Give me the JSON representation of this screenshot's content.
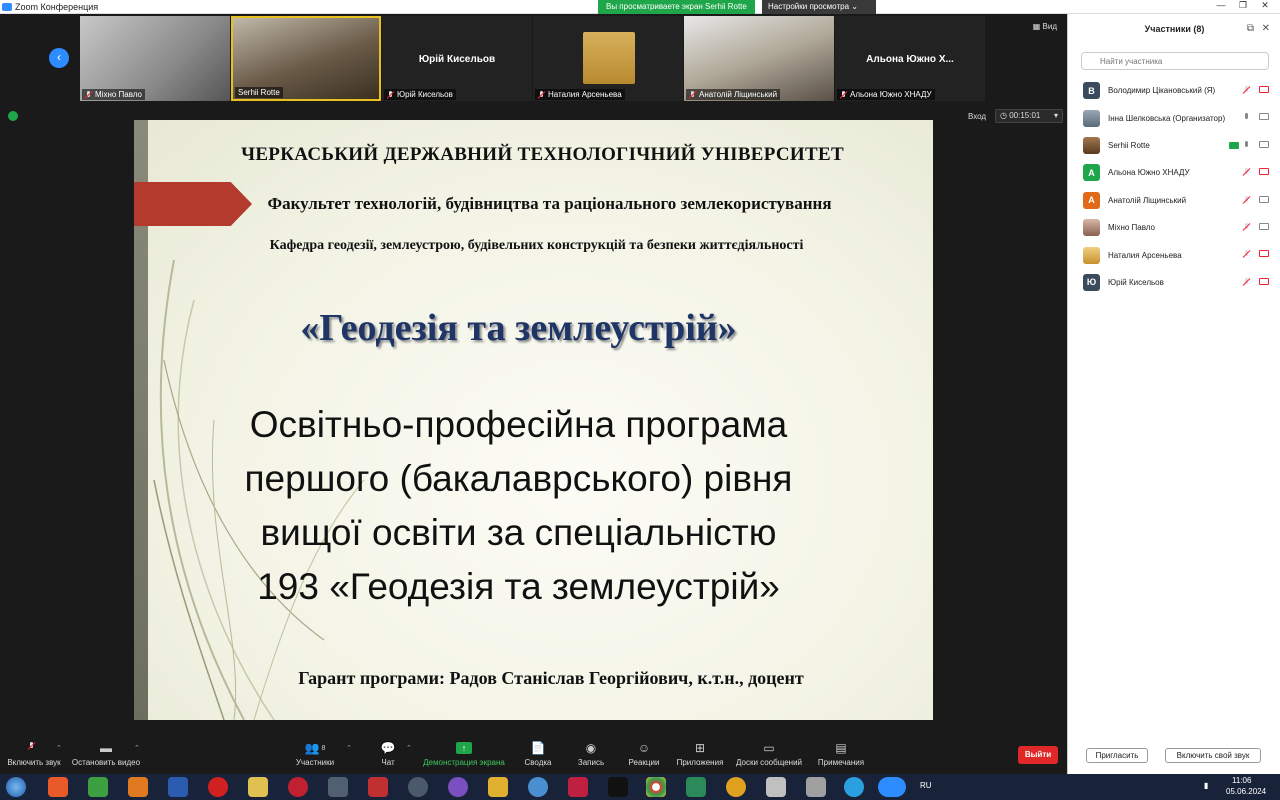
{
  "window": {
    "title": "Zoom Конференция",
    "share_banner": "Вы просматриваете экран Serhii Rotte",
    "view_options": "Настройки просмотра",
    "view_label": "Вид",
    "enter_label": "Вход",
    "timer": "00:15:01"
  },
  "thumbnails": [
    {
      "name": "Міхно Павло",
      "center": ""
    },
    {
      "name": "Serhii Rotte",
      "center": ""
    },
    {
      "name": "Юрій Кисельов",
      "center": "Юрій Кисельов"
    },
    {
      "name": "Наталия Арсеньева",
      "center": ""
    },
    {
      "name": "Анатолій Ліщинський",
      "center": ""
    },
    {
      "name": "Альона Южно ХНАДУ",
      "center": "Альона Южно Х..."
    }
  ],
  "slide": {
    "university": "ЧЕРКАСЬКИЙ  ДЕРЖАВНИЙ ТЕХНОЛОГІЧНИЙ  УНІВЕРСИТЕТ",
    "faculty": "Факультет технологій, будівництва та раціонального землекористування",
    "department": "Кафедра геодезії, землеустрою, будівельних конструкцій та безпеки життєдіяльності",
    "program_name": "«Геодезія та землеустрій»",
    "program_lines": [
      "Освітньо-професійна програма",
      "першого (бакалаврського) рівня",
      "вищої освіти за спеціальністю",
      "193 «Геодезія та землеустрій»"
    ],
    "guarantor": "Гарант програми: Радов Станіслав Георгійович, к.т.н., доцент"
  },
  "participants": {
    "title": "Участники (8)",
    "search_placeholder": "Найти участника",
    "list": [
      {
        "initial": "В",
        "color": "#3b4a5c",
        "name": "Володимир Цікановський (Я)",
        "mic": "off",
        "cam": "off"
      },
      {
        "initial": "",
        "color": "#7a8a99",
        "name": "Інна Шелковська (Организатор)",
        "mic": "on",
        "cam": "on"
      },
      {
        "initial": "",
        "color": "#7a5a40",
        "name": "Serhii Rotte",
        "mic": "on",
        "cam": "on",
        "sharing": true
      },
      {
        "initial": "А",
        "color": "#1fa64a",
        "name": "Альона Южно ХНАДУ",
        "mic": "off",
        "cam": "off"
      },
      {
        "initial": "А",
        "color": "#e06a1a",
        "name": "Анатолій Ліщинський",
        "mic": "off",
        "cam": "on"
      },
      {
        "initial": "",
        "color": "#b08070",
        "name": "Міхно Павло",
        "mic": "off",
        "cam": "on"
      },
      {
        "initial": "",
        "color": "#d0a040",
        "name": "Наталия Арсеньева",
        "mic": "off",
        "cam": "off"
      },
      {
        "initial": "Ю",
        "color": "#3b4a5c",
        "name": "Юрій Кисельов",
        "mic": "off",
        "cam": "off"
      }
    ],
    "invite_button": "Пригласить",
    "unmute_button": "Включить свой звук"
  },
  "toolbar": {
    "unmute": "Включить звук",
    "stop_video": "Остановить видео",
    "participants": "Участники",
    "participants_count": "8",
    "chat": "Чат",
    "share": "Демонстрация экрана",
    "summary": "Сводка",
    "record": "Запись",
    "reactions": "Реакции",
    "apps": "Приложения",
    "whiteboards": "Доски сообщений",
    "notes": "Примечания",
    "leave": "Выйти"
  },
  "taskbar": {
    "lang": "RU",
    "time": "11:06",
    "date": "05.06.2024"
  }
}
